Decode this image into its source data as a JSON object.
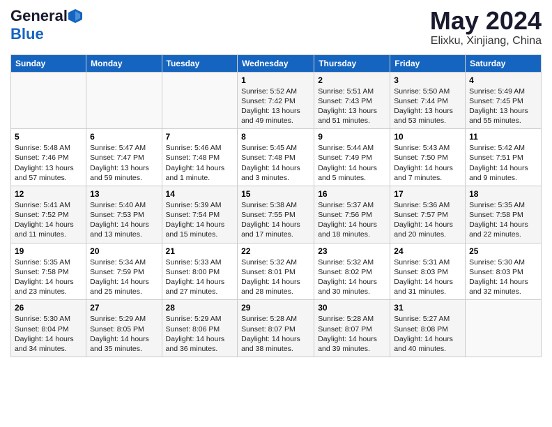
{
  "header": {
    "logo_general": "General",
    "logo_blue": "Blue",
    "title": "May 2024",
    "subtitle": "Elixku, Xinjiang, China"
  },
  "days_of_week": [
    "Sunday",
    "Monday",
    "Tuesday",
    "Wednesday",
    "Thursday",
    "Friday",
    "Saturday"
  ],
  "weeks": [
    [
      {
        "day": "",
        "info": ""
      },
      {
        "day": "",
        "info": ""
      },
      {
        "day": "",
        "info": ""
      },
      {
        "day": "1",
        "info": "Sunrise: 5:52 AM\nSunset: 7:42 PM\nDaylight: 13 hours\nand 49 minutes."
      },
      {
        "day": "2",
        "info": "Sunrise: 5:51 AM\nSunset: 7:43 PM\nDaylight: 13 hours\nand 51 minutes."
      },
      {
        "day": "3",
        "info": "Sunrise: 5:50 AM\nSunset: 7:44 PM\nDaylight: 13 hours\nand 53 minutes."
      },
      {
        "day": "4",
        "info": "Sunrise: 5:49 AM\nSunset: 7:45 PM\nDaylight: 13 hours\nand 55 minutes."
      }
    ],
    [
      {
        "day": "5",
        "info": "Sunrise: 5:48 AM\nSunset: 7:46 PM\nDaylight: 13 hours\nand 57 minutes."
      },
      {
        "day": "6",
        "info": "Sunrise: 5:47 AM\nSunset: 7:47 PM\nDaylight: 13 hours\nand 59 minutes."
      },
      {
        "day": "7",
        "info": "Sunrise: 5:46 AM\nSunset: 7:48 PM\nDaylight: 14 hours\nand 1 minute."
      },
      {
        "day": "8",
        "info": "Sunrise: 5:45 AM\nSunset: 7:48 PM\nDaylight: 14 hours\nand 3 minutes."
      },
      {
        "day": "9",
        "info": "Sunrise: 5:44 AM\nSunset: 7:49 PM\nDaylight: 14 hours\nand 5 minutes."
      },
      {
        "day": "10",
        "info": "Sunrise: 5:43 AM\nSunset: 7:50 PM\nDaylight: 14 hours\nand 7 minutes."
      },
      {
        "day": "11",
        "info": "Sunrise: 5:42 AM\nSunset: 7:51 PM\nDaylight: 14 hours\nand 9 minutes."
      }
    ],
    [
      {
        "day": "12",
        "info": "Sunrise: 5:41 AM\nSunset: 7:52 PM\nDaylight: 14 hours\nand 11 minutes."
      },
      {
        "day": "13",
        "info": "Sunrise: 5:40 AM\nSunset: 7:53 PM\nDaylight: 14 hours\nand 13 minutes."
      },
      {
        "day": "14",
        "info": "Sunrise: 5:39 AM\nSunset: 7:54 PM\nDaylight: 14 hours\nand 15 minutes."
      },
      {
        "day": "15",
        "info": "Sunrise: 5:38 AM\nSunset: 7:55 PM\nDaylight: 14 hours\nand 17 minutes."
      },
      {
        "day": "16",
        "info": "Sunrise: 5:37 AM\nSunset: 7:56 PM\nDaylight: 14 hours\nand 18 minutes."
      },
      {
        "day": "17",
        "info": "Sunrise: 5:36 AM\nSunset: 7:57 PM\nDaylight: 14 hours\nand 20 minutes."
      },
      {
        "day": "18",
        "info": "Sunrise: 5:35 AM\nSunset: 7:58 PM\nDaylight: 14 hours\nand 22 minutes."
      }
    ],
    [
      {
        "day": "19",
        "info": "Sunrise: 5:35 AM\nSunset: 7:58 PM\nDaylight: 14 hours\nand 23 minutes."
      },
      {
        "day": "20",
        "info": "Sunrise: 5:34 AM\nSunset: 7:59 PM\nDaylight: 14 hours\nand 25 minutes."
      },
      {
        "day": "21",
        "info": "Sunrise: 5:33 AM\nSunset: 8:00 PM\nDaylight: 14 hours\nand 27 minutes."
      },
      {
        "day": "22",
        "info": "Sunrise: 5:32 AM\nSunset: 8:01 PM\nDaylight: 14 hours\nand 28 minutes."
      },
      {
        "day": "23",
        "info": "Sunrise: 5:32 AM\nSunset: 8:02 PM\nDaylight: 14 hours\nand 30 minutes."
      },
      {
        "day": "24",
        "info": "Sunrise: 5:31 AM\nSunset: 8:03 PM\nDaylight: 14 hours\nand 31 minutes."
      },
      {
        "day": "25",
        "info": "Sunrise: 5:30 AM\nSunset: 8:03 PM\nDaylight: 14 hours\nand 32 minutes."
      }
    ],
    [
      {
        "day": "26",
        "info": "Sunrise: 5:30 AM\nSunset: 8:04 PM\nDaylight: 14 hours\nand 34 minutes."
      },
      {
        "day": "27",
        "info": "Sunrise: 5:29 AM\nSunset: 8:05 PM\nDaylight: 14 hours\nand 35 minutes."
      },
      {
        "day": "28",
        "info": "Sunrise: 5:29 AM\nSunset: 8:06 PM\nDaylight: 14 hours\nand 36 minutes."
      },
      {
        "day": "29",
        "info": "Sunrise: 5:28 AM\nSunset: 8:07 PM\nDaylight: 14 hours\nand 38 minutes."
      },
      {
        "day": "30",
        "info": "Sunrise: 5:28 AM\nSunset: 8:07 PM\nDaylight: 14 hours\nand 39 minutes."
      },
      {
        "day": "31",
        "info": "Sunrise: 5:27 AM\nSunset: 8:08 PM\nDaylight: 14 hours\nand 40 minutes."
      },
      {
        "day": "",
        "info": ""
      }
    ]
  ]
}
